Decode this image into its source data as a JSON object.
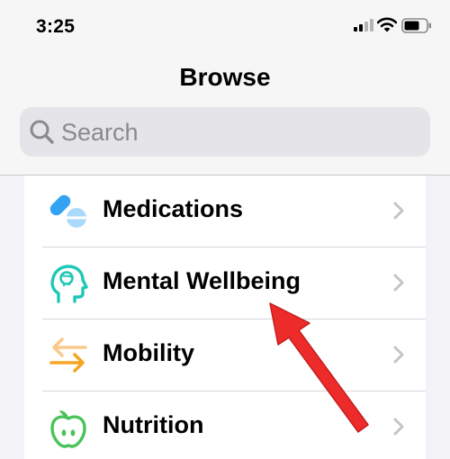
{
  "status_bar": {
    "time": "3:25",
    "icons": [
      "cellular-signal-icon",
      "wifi-icon",
      "battery-icon"
    ]
  },
  "header": {
    "title": "Browse"
  },
  "search": {
    "placeholder": "Search"
  },
  "categories": [
    {
      "label": "Medications",
      "icon": "pills-icon",
      "color": "#35a3f4"
    },
    {
      "label": "Mental Wellbeing",
      "icon": "head-brain-icon",
      "color": "#1fc7b6"
    },
    {
      "label": "Mobility",
      "icon": "arrows-exchange-icon",
      "color": "#f5a523"
    },
    {
      "label": "Nutrition",
      "icon": "apple-icon",
      "color": "#48c35a"
    }
  ],
  "annotation": {
    "icon": "red-arrow-pointer-icon",
    "color": "#ee2b2b"
  }
}
